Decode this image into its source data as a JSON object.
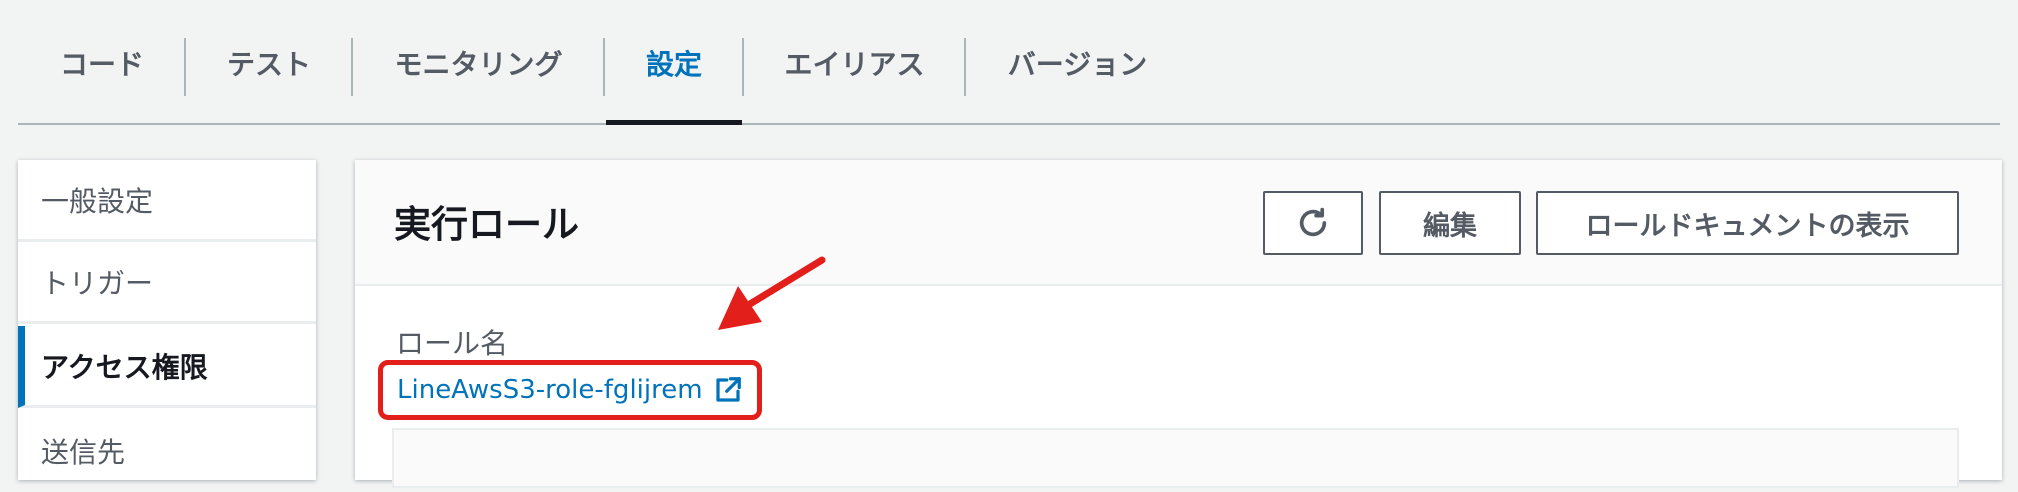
{
  "tabs": [
    {
      "label": "コード"
    },
    {
      "label": "テスト"
    },
    {
      "label": "モニタリング"
    },
    {
      "label": "設定"
    },
    {
      "label": "エイリアス"
    },
    {
      "label": "バージョン"
    }
  ],
  "active_tab": "設定",
  "sidenav": {
    "items": [
      {
        "label": "一般設定"
      },
      {
        "label": "トリガー"
      },
      {
        "label": "アクセス権限"
      },
      {
        "label": "送信先"
      }
    ],
    "active": "アクセス権限"
  },
  "panel": {
    "title": "実行ロール",
    "refresh_icon": "refresh-icon",
    "edit_label": "編集",
    "view_doc_label": "ロールドキュメントの表示",
    "role_name_label": "ロール名",
    "role_name_value": "LineAwsS3-role-fglijrem",
    "link_icon": "external-link-icon"
  },
  "annotation": {
    "highlight_color": "#e21f1b",
    "arrow_color": "#e21f1b"
  },
  "colors": {
    "accent": "#0073bb",
    "text": "#16191f",
    "muted": "#545b64"
  }
}
